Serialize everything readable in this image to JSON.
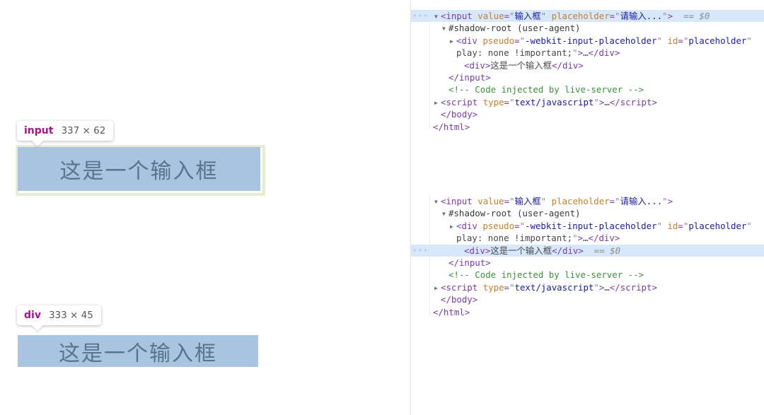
{
  "page": {
    "inspected_elements": [
      {
        "tooltip_tag": "input",
        "tooltip_dims": "337 × 62",
        "box_text": "这是一个输入框"
      },
      {
        "tooltip_tag": "div",
        "tooltip_dims": "333 × 45",
        "box_text": "这是一个输入框"
      }
    ],
    "colors": {
      "highlight_fill": "#a8c4e0",
      "highlight_text": "#5b738c",
      "tooltip_tag_color": "#a61390",
      "selected_row": "#d7e8fb"
    }
  },
  "devtools": {
    "blocks": [
      {
        "name": "dom-tree-input-selected",
        "lines": [
          {
            "selected": true,
            "gutter": "…",
            "indent": 1,
            "triangle": "open",
            "tokens": [
              {
                "c": "t-punc",
                "t": "<"
              },
              {
                "c": "t-tag",
                "t": "input"
              },
              {
                "c": "t-text",
                "t": " "
              },
              {
                "c": "t-attr",
                "t": "value"
              },
              {
                "c": "t-punc",
                "t": "="
              },
              {
                "c": "t-quote",
                "t": "\""
              },
              {
                "c": "t-val",
                "t": "输入框"
              },
              {
                "c": "t-quote",
                "t": "\""
              },
              {
                "c": "t-text",
                "t": " "
              },
              {
                "c": "t-attr",
                "t": "placeholder"
              },
              {
                "c": "t-punc",
                "t": "="
              },
              {
                "c": "t-quote",
                "t": "\""
              },
              {
                "c": "t-val",
                "t": "请输入..."
              },
              {
                "c": "t-quote",
                "t": "\""
              },
              {
                "c": "t-punc",
                "t": ">"
              },
              {
                "c": "t-ref",
                "t": "  == $0"
              }
            ]
          },
          {
            "selected": false,
            "gutter": "",
            "indent": 2,
            "triangle": "open",
            "tokens": [
              {
                "c": "t-sd",
                "t": "#shadow-root (user-agent)"
              }
            ]
          },
          {
            "selected": false,
            "gutter": "",
            "indent": 3,
            "triangle": "closed",
            "tokens": [
              {
                "c": "t-punc",
                "t": "<"
              },
              {
                "c": "t-tag",
                "t": "div"
              },
              {
                "c": "t-text",
                "t": " "
              },
              {
                "c": "t-attr",
                "t": "pseudo"
              },
              {
                "c": "t-punc",
                "t": "="
              },
              {
                "c": "t-quote",
                "t": "\""
              },
              {
                "c": "t-val",
                "t": "-webkit-input-placeholder"
              },
              {
                "c": "t-quote",
                "t": "\""
              },
              {
                "c": "t-text",
                "t": " "
              },
              {
                "c": "t-attr",
                "t": "id"
              },
              {
                "c": "t-punc",
                "t": "="
              },
              {
                "c": "t-quote",
                "t": "\""
              },
              {
                "c": "t-val",
                "t": "placeholder"
              },
              {
                "c": "t-quote",
                "t": "\""
              }
            ]
          },
          {
            "selected": false,
            "gutter": "",
            "indent": 3,
            "triangle": "none",
            "tokens": [
              {
                "c": "t-text",
                "t": "play: none !important;"
              },
              {
                "c": "t-quote",
                "t": "\""
              },
              {
                "c": "t-punc",
                "t": ">"
              },
              {
                "c": "t-text",
                "t": "…"
              },
              {
                "c": "t-punc",
                "t": "</"
              },
              {
                "c": "t-tag",
                "t": "div"
              },
              {
                "c": "t-punc",
                "t": ">"
              }
            ]
          },
          {
            "selected": false,
            "gutter": "",
            "indent": 4,
            "triangle": "none",
            "tokens": [
              {
                "c": "t-punc",
                "t": "<"
              },
              {
                "c": "t-tag",
                "t": "div"
              },
              {
                "c": "t-punc",
                "t": ">"
              },
              {
                "c": "t-text",
                "t": "这是一个输入框"
              },
              {
                "c": "t-punc",
                "t": "</"
              },
              {
                "c": "t-tag",
                "t": "div"
              },
              {
                "c": "t-punc",
                "t": ">"
              }
            ]
          },
          {
            "selected": false,
            "gutter": "",
            "indent": 2,
            "triangle": "none",
            "tokens": [
              {
                "c": "t-punc",
                "t": "</"
              },
              {
                "c": "t-tag",
                "t": "input"
              },
              {
                "c": "t-punc",
                "t": ">"
              }
            ]
          },
          {
            "selected": false,
            "gutter": "",
            "indent": 2,
            "triangle": "none",
            "tokens": [
              {
                "c": "t-cmt",
                "t": "<!-- Code injected by live-server -->"
              }
            ]
          },
          {
            "selected": false,
            "gutter": "",
            "indent": 1,
            "triangle": "closed",
            "tokens": [
              {
                "c": "t-punc",
                "t": "<"
              },
              {
                "c": "t-tag",
                "t": "script"
              },
              {
                "c": "t-text",
                "t": " "
              },
              {
                "c": "t-attr",
                "t": "type"
              },
              {
                "c": "t-punc",
                "t": "="
              },
              {
                "c": "t-quote",
                "t": "\""
              },
              {
                "c": "t-val",
                "t": "text/javascript"
              },
              {
                "c": "t-quote",
                "t": "\""
              },
              {
                "c": "t-punc",
                "t": ">"
              },
              {
                "c": "t-text",
                "t": "…"
              },
              {
                "c": "t-punc",
                "t": "</"
              },
              {
                "c": "t-tag",
                "t": "script"
              },
              {
                "c": "t-punc",
                "t": ">"
              }
            ]
          },
          {
            "selected": false,
            "gutter": "",
            "indent": 1,
            "triangle": "none",
            "tokens": [
              {
                "c": "t-punc",
                "t": "</"
              },
              {
                "c": "t-tag",
                "t": "body"
              },
              {
                "c": "t-punc",
                "t": ">"
              }
            ]
          },
          {
            "selected": false,
            "gutter": "",
            "indent": 0,
            "triangle": "none",
            "tokens": [
              {
                "c": "t-punc",
                "t": "</"
              },
              {
                "c": "t-tag",
                "t": "html"
              },
              {
                "c": "t-punc",
                "t": ">"
              }
            ]
          }
        ]
      },
      {
        "name": "dom-tree-div-selected",
        "lines": [
          {
            "selected": false,
            "gutter": "",
            "indent": 1,
            "triangle": "open",
            "tokens": [
              {
                "c": "t-punc",
                "t": "<"
              },
              {
                "c": "t-tag",
                "t": "input"
              },
              {
                "c": "t-text",
                "t": " "
              },
              {
                "c": "t-attr",
                "t": "value"
              },
              {
                "c": "t-punc",
                "t": "="
              },
              {
                "c": "t-quote",
                "t": "\""
              },
              {
                "c": "t-val",
                "t": "输入框"
              },
              {
                "c": "t-quote",
                "t": "\""
              },
              {
                "c": "t-text",
                "t": " "
              },
              {
                "c": "t-attr",
                "t": "placeholder"
              },
              {
                "c": "t-punc",
                "t": "="
              },
              {
                "c": "t-quote",
                "t": "\""
              },
              {
                "c": "t-val",
                "t": "请输入..."
              },
              {
                "c": "t-quote",
                "t": "\""
              },
              {
                "c": "t-punc",
                "t": ">"
              }
            ]
          },
          {
            "selected": false,
            "gutter": "",
            "indent": 2,
            "triangle": "open",
            "tokens": [
              {
                "c": "t-sd",
                "t": "#shadow-root (user-agent)"
              }
            ]
          },
          {
            "selected": false,
            "gutter": "",
            "indent": 3,
            "triangle": "closed",
            "tokens": [
              {
                "c": "t-punc",
                "t": "<"
              },
              {
                "c": "t-tag",
                "t": "div"
              },
              {
                "c": "t-text",
                "t": " "
              },
              {
                "c": "t-attr",
                "t": "pseudo"
              },
              {
                "c": "t-punc",
                "t": "="
              },
              {
                "c": "t-quote",
                "t": "\""
              },
              {
                "c": "t-val",
                "t": "-webkit-input-placeholder"
              },
              {
                "c": "t-quote",
                "t": "\""
              },
              {
                "c": "t-text",
                "t": " "
              },
              {
                "c": "t-attr",
                "t": "id"
              },
              {
                "c": "t-punc",
                "t": "="
              },
              {
                "c": "t-quote",
                "t": "\""
              },
              {
                "c": "t-val",
                "t": "placeholder"
              },
              {
                "c": "t-quote",
                "t": "\""
              }
            ]
          },
          {
            "selected": false,
            "gutter": "",
            "indent": 3,
            "triangle": "none",
            "tokens": [
              {
                "c": "t-text",
                "t": "play: none !important;"
              },
              {
                "c": "t-quote",
                "t": "\""
              },
              {
                "c": "t-punc",
                "t": ">"
              },
              {
                "c": "t-text",
                "t": "…"
              },
              {
                "c": "t-punc",
                "t": "</"
              },
              {
                "c": "t-tag",
                "t": "div"
              },
              {
                "c": "t-punc",
                "t": ">"
              }
            ]
          },
          {
            "selected": true,
            "gutter": "…",
            "indent": 4,
            "triangle": "none",
            "tokens": [
              {
                "c": "t-punc",
                "t": "<"
              },
              {
                "c": "t-tag",
                "t": "div"
              },
              {
                "c": "t-punc",
                "t": ">"
              },
              {
                "c": "t-text",
                "t": "这是一个输入框"
              },
              {
                "c": "t-punc",
                "t": "</"
              },
              {
                "c": "t-tag",
                "t": "div"
              },
              {
                "c": "t-punc",
                "t": ">"
              },
              {
                "c": "t-ref",
                "t": "  == $0"
              }
            ]
          },
          {
            "selected": false,
            "gutter": "",
            "indent": 2,
            "triangle": "none",
            "tokens": [
              {
                "c": "t-punc",
                "t": "</"
              },
              {
                "c": "t-tag",
                "t": "input"
              },
              {
                "c": "t-punc",
                "t": ">"
              }
            ]
          },
          {
            "selected": false,
            "gutter": "",
            "indent": 2,
            "triangle": "none",
            "tokens": [
              {
                "c": "t-cmt",
                "t": "<!-- Code injected by live-server -->"
              }
            ]
          },
          {
            "selected": false,
            "gutter": "",
            "indent": 1,
            "triangle": "closed",
            "tokens": [
              {
                "c": "t-punc",
                "t": "<"
              },
              {
                "c": "t-tag",
                "t": "script"
              },
              {
                "c": "t-text",
                "t": " "
              },
              {
                "c": "t-attr",
                "t": "type"
              },
              {
                "c": "t-punc",
                "t": "="
              },
              {
                "c": "t-quote",
                "t": "\""
              },
              {
                "c": "t-val",
                "t": "text/javascript"
              },
              {
                "c": "t-quote",
                "t": "\""
              },
              {
                "c": "t-punc",
                "t": ">"
              },
              {
                "c": "t-text",
                "t": "…"
              },
              {
                "c": "t-punc",
                "t": "</"
              },
              {
                "c": "t-tag",
                "t": "script"
              },
              {
                "c": "t-punc",
                "t": ">"
              }
            ]
          },
          {
            "selected": false,
            "gutter": "",
            "indent": 1,
            "triangle": "none",
            "tokens": [
              {
                "c": "t-punc",
                "t": "</"
              },
              {
                "c": "t-tag",
                "t": "body"
              },
              {
                "c": "t-punc",
                "t": ">"
              }
            ]
          },
          {
            "selected": false,
            "gutter": "",
            "indent": 0,
            "triangle": "none",
            "tokens": [
              {
                "c": "t-punc",
                "t": "</"
              },
              {
                "c": "t-tag",
                "t": "html"
              },
              {
                "c": "t-punc",
                "t": ">"
              }
            ]
          }
        ]
      }
    ]
  }
}
